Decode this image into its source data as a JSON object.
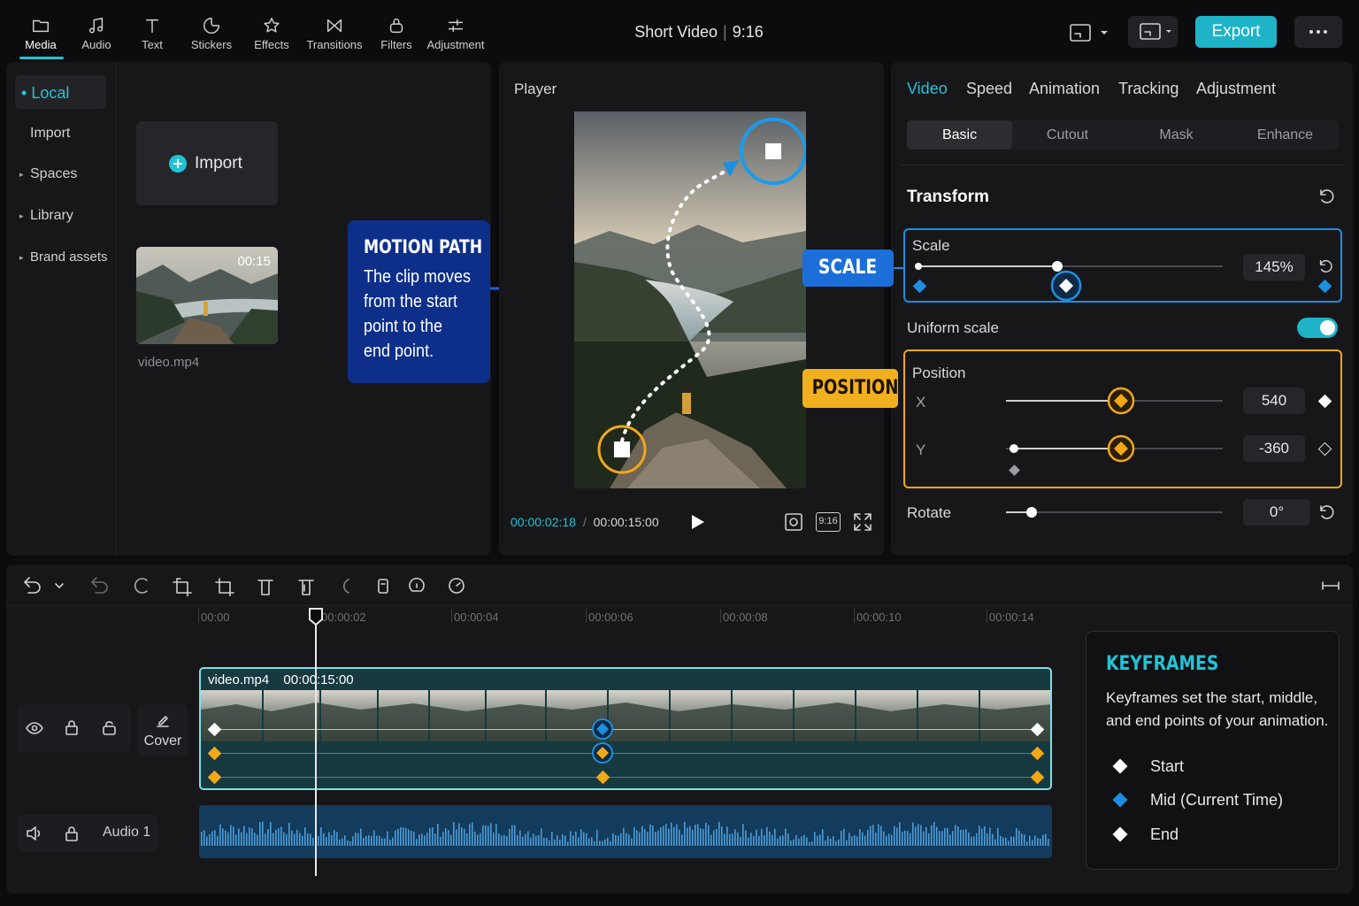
{
  "toolbar": {
    "tools": [
      {
        "label": "Media",
        "icon": "folder-icon"
      },
      {
        "label": "Audio",
        "icon": "music-note-icon"
      },
      {
        "label": "Text",
        "icon": "text-icon"
      },
      {
        "label": "Stickers",
        "icon": "sticker-icon"
      },
      {
        "label": "Effects",
        "icon": "star-icon"
      },
      {
        "label": "Transitions",
        "icon": "transition-icon"
      },
      {
        "label": "Filters",
        "icon": "filter-icon"
      },
      {
        "label": "Adjustment",
        "icon": "sliders-icon"
      }
    ],
    "active_tool": "Media",
    "project_title": "Short Video",
    "aspect_ratio": "9:16",
    "export_label": "Export",
    "accent_color": "#1fb3c8"
  },
  "sidebar": {
    "items": [
      {
        "label": "Local",
        "active": true
      },
      {
        "label": "Import"
      },
      {
        "label": "Spaces"
      },
      {
        "label": "Library"
      },
      {
        "label": "Brand assets"
      }
    ]
  },
  "media": {
    "import_label": "Import",
    "clip_name": "video.mp4",
    "clip_duration": "00:15"
  },
  "callouts": {
    "motion_path_title": "MOTION PATH",
    "motion_path_lines": [
      "The clip moves",
      "from the start",
      "point to the",
      "end point."
    ],
    "scale_badge": "SCALE",
    "position_badge": "POSITION"
  },
  "player": {
    "title": "Player",
    "current_time": "00:00:02:18",
    "separator": "/",
    "total_time": "00:00:15:00",
    "ratio_button": "9:16"
  },
  "inspector": {
    "tabs": [
      "Video",
      "Speed",
      "Animation",
      "Tracking",
      "Adjustment"
    ],
    "active_tab": "Video",
    "subtabs": [
      "Basic",
      "Cutout",
      "Mask",
      "Enhance"
    ],
    "active_subtab": "Basic",
    "section_title": "Transform",
    "scale": {
      "label": "Scale",
      "value": "145%",
      "level": 0.46
    },
    "uniform_scale": {
      "label": "Uniform scale",
      "on": true
    },
    "position": {
      "label": "Position",
      "x_label": "X",
      "x_value": "540",
      "y_label": "Y",
      "y_value": "-360"
    },
    "rotate": {
      "label": "Rotate",
      "value": "0°",
      "level": 0.12
    }
  },
  "timeline": {
    "ticks": [
      "00:00",
      "00:00:02",
      "00:00:04",
      "00:00:06",
      "00:00:08",
      "00:00:10",
      "00:00:14"
    ],
    "clip_label": "video.mp4",
    "clip_duration": "00:00:15:00",
    "cover_label": "Cover",
    "audio_label": "Audio 1"
  },
  "keyframes_box": {
    "title": "KEYFRAMES",
    "body": "Keyframes set the start, middle, and end points of your animation.",
    "legend": [
      {
        "label": "Start",
        "color": "#ffffff"
      },
      {
        "label": "Mid (Current Time)",
        "color": "#1c8fe0"
      },
      {
        "label": "End",
        "color": "#ffffff"
      }
    ]
  }
}
